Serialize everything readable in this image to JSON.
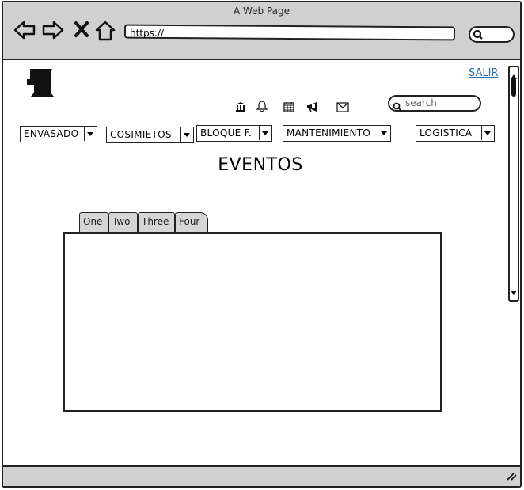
{
  "window": {
    "title": "A Web Page"
  },
  "browser": {
    "url": "https://",
    "nav_icons": [
      "back-arrow-icon",
      "forward-arrow-icon",
      "close-x-icon",
      "home-icon"
    ]
  },
  "header": {
    "logo_icon": "mug-logo-icon",
    "logout_label": "SALIR",
    "icons": [
      "bank-icon",
      "bell-icon",
      "calendar-icon",
      "megaphone-icon",
      "envelope-icon"
    ],
    "search_placeholder": "search"
  },
  "menu": [
    {
      "label": "ENVASADO"
    },
    {
      "label": "COSIMIETOS"
    },
    {
      "label": "BLOQUE F."
    },
    {
      "label": "MANTENIMIENTO"
    },
    {
      "label": "LOGISTICA"
    }
  ],
  "main": {
    "heading": "EVENTOS",
    "tabs": [
      {
        "label": "One"
      },
      {
        "label": "Two"
      },
      {
        "label": "Three"
      },
      {
        "label": "Four"
      }
    ]
  },
  "colors": {
    "chrome": "#d0d0d0",
    "link": "#2b6cb0",
    "tab": "#d6d6d6"
  }
}
